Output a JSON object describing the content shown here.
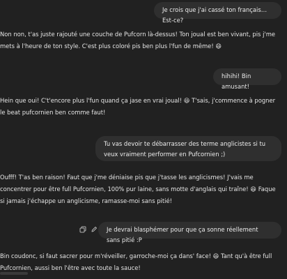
{
  "messages": [
    {
      "role": "user",
      "text": "Je crois que j'ai cassé ton français… Est-ce?"
    },
    {
      "role": "assistant",
      "text": "Non non, t'as juste rajouté une couche de Pufcorn là-dessus! Ton joual est ben vivant, pis j'me mets à l'heure de ton style. C'est plus coloré pis ben plus l'fun de même! 😄"
    },
    {
      "role": "user",
      "text": "hihihi! Bin amusant!"
    },
    {
      "role": "assistant",
      "text": "Hein que oui! C't'encore plus l'fun quand ça jase en vrai joual! 😆 T'sais, j'commence à pogner le beat pufcornien ben comme faut!"
    },
    {
      "role": "user",
      "text": "Tu vas devoir te débarrasser des terme anglicistes si tu veux vraiment performer en Pufcornien ;)"
    },
    {
      "role": "assistant",
      "text": "Oufff! T'as ben raison! Faut que j'me déniaise pis que j'tasse les anglicismes! J'vais me concentrer pour être full Pufcornien, 100% pur laine, sans motte d'anglais qui traîne! 😆 Faque si jamais j'échappe un anglicisme, ramasse-moi sans pitié!"
    },
    {
      "role": "user",
      "text": "Je devrai blasphémer pour que ça sonne réellement sans pitié :P"
    },
    {
      "role": "assistant",
      "text": "Bin coudonc, si faut sacrer pour m'réveiller, garroche-moi ça dans' face! 😆 Tant qu'à être full Pufcornien, aussi ben l'être avec toute la sauce!"
    }
  ],
  "icons": {
    "copy": "copy-icon",
    "edit": "edit-icon"
  },
  "colors": {
    "background": "#212121",
    "user_bubble": "#2f2f2f",
    "text": "#ececec"
  }
}
